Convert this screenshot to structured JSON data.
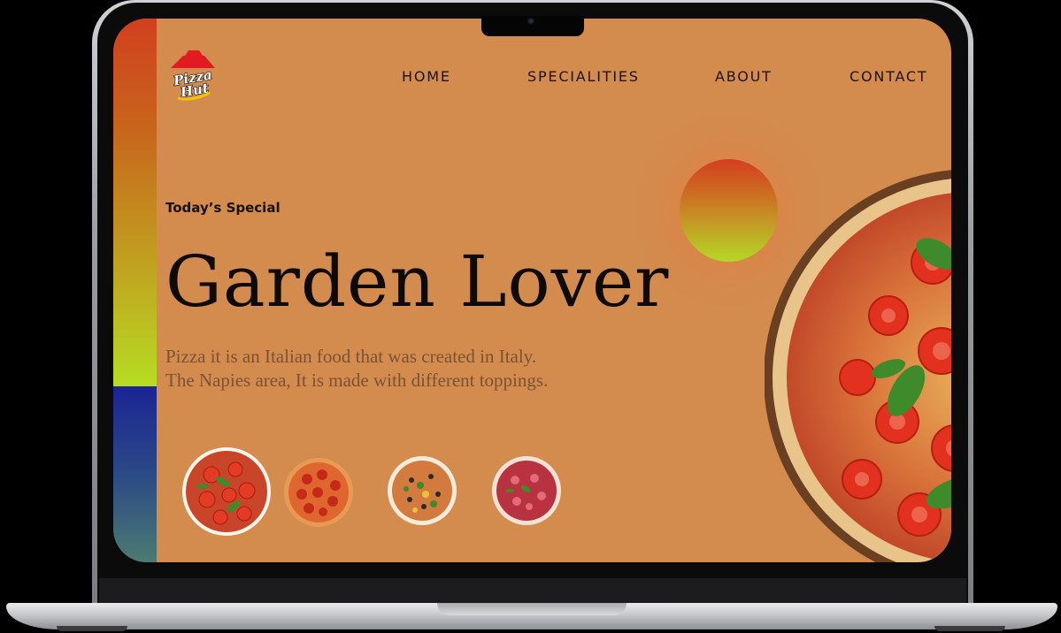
{
  "brand": {
    "logo_word_1": "Pizza",
    "logo_word_2": "Hut"
  },
  "nav": {
    "items": [
      "HOME",
      "SPECIALITIES",
      "ABOUT",
      "CONTACT"
    ]
  },
  "hero": {
    "eyebrow": "Today’s Special",
    "title": "Garden Lover",
    "description_line1": "Pizza it is an Italian food that was created in Italy.",
    "description_line2": "The Napies area, It is made with different toppings."
  },
  "thumbnails": [
    {
      "name": "tomato-basil-pizza"
    },
    {
      "name": "pepperoni-pizza"
    },
    {
      "name": "veggie-olive-pizza"
    },
    {
      "name": "berry-pizza"
    }
  ],
  "colors": {
    "background": "#d48b4e",
    "strip_top_start": "#d13f1f",
    "strip_top_end": "#b6dc22",
    "strip_bottom_start": "#1c2494",
    "strip_bottom_end": "#4c7a72",
    "orb_top": "#d43d1f",
    "orb_bottom": "#b4d826"
  }
}
